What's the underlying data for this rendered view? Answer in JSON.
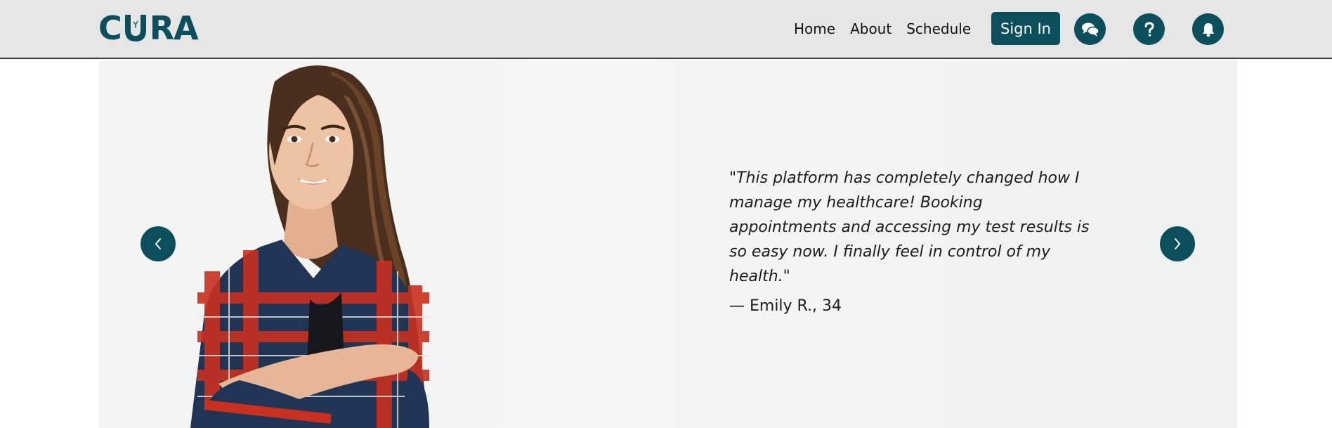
{
  "brand": {
    "logo_text_left": "C",
    "logo_text_right": "RA",
    "logo_alt": "CURA",
    "color": "#0b4f5c"
  },
  "nav": {
    "links": [
      {
        "label": "Home"
      },
      {
        "label": "About"
      },
      {
        "label": "Schedule"
      }
    ],
    "signin_label": "Sign In",
    "icons": [
      {
        "name": "chat-icon"
      },
      {
        "name": "help-icon"
      },
      {
        "name": "bell-icon"
      }
    ]
  },
  "testimonial": {
    "quote": "\"This platform has completely changed how I manage my healthcare! Booking appointments and accessing my test results is so easy now. I finally feel in control of my health.\"",
    "author": "— Emily R., 34"
  },
  "carousel": {
    "prev_icon": "chevron-left-icon",
    "next_icon": "chevron-right-icon"
  },
  "colors": {
    "accent": "#0b4f5c",
    "navbar_bg": "#e6e6e7"
  }
}
